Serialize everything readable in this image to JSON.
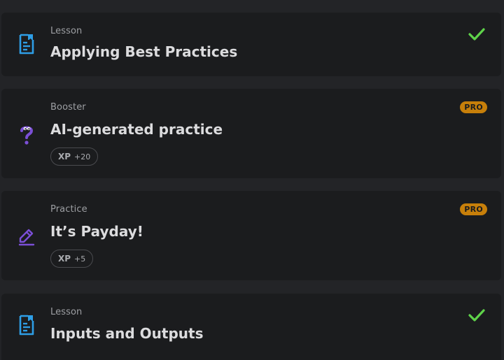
{
  "items": [
    {
      "type_label": "Lesson",
      "title": "Applying Best Practices",
      "icon": "lesson-icon",
      "status": "completed"
    },
    {
      "type_label": "Booster",
      "title": "AI-generated practice",
      "icon": "question-mark-icon",
      "badge": "PRO",
      "xp_label": "XP",
      "xp_value": "+20"
    },
    {
      "type_label": "Practice",
      "title": "It’s Payday!",
      "icon": "pencil-icon",
      "badge": "PRO",
      "xp_label": "XP",
      "xp_value": "+5"
    },
    {
      "type_label": "Lesson",
      "title": "Inputs and Outputs",
      "icon": "lesson-icon",
      "status": "completed"
    }
  ],
  "colors": {
    "lesson_icon": "#2e9ee6",
    "booster_icon": "#7b4fd6",
    "practice_icon": "#7b4fd6",
    "check": "#5fd34a",
    "pro_badge": "#c77f0a"
  }
}
